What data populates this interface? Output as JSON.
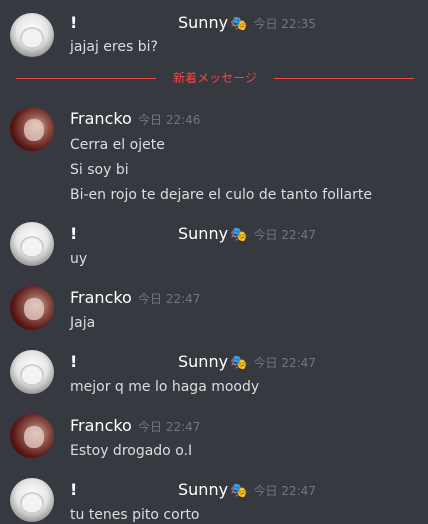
{
  "divider_label": "新着メッセージ",
  "messages": [
    {
      "author": "!",
      "display": "Sunny",
      "badge": "🎭",
      "time": "今日 22:35",
      "lines": [
        "jajaj eres bi?"
      ]
    },
    {
      "author": "Francko",
      "time": "今日 22:46",
      "lines": [
        "Cerra el ojete",
        "Si soy bi",
        "Bi-en rojo te dejare el culo de tanto follarte"
      ]
    },
    {
      "author": "!",
      "display": "Sunny",
      "badge": "🎭",
      "time": "今日 22:47",
      "lines": [
        "uy"
      ]
    },
    {
      "author": "Francko",
      "time": "今日 22:47",
      "lines": [
        "Jaja"
      ]
    },
    {
      "author": "!",
      "display": "Sunny",
      "badge": "🎭",
      "time": "今日 22:47",
      "lines": [
        "mejor q me lo haga moody"
      ]
    },
    {
      "author": "Francko",
      "time": "今日 22:47",
      "lines": [
        "Estoy drogado o.I"
      ]
    },
    {
      "author": "!",
      "display": "Sunny",
      "badge": "🎭",
      "time": "今日 22:47",
      "lines": [
        "tu tenes pito corto"
      ]
    }
  ],
  "colors": {
    "background": "#36393f",
    "text": "#dcddde",
    "timestamp": "#72767d",
    "new_divider": "#f04747"
  }
}
